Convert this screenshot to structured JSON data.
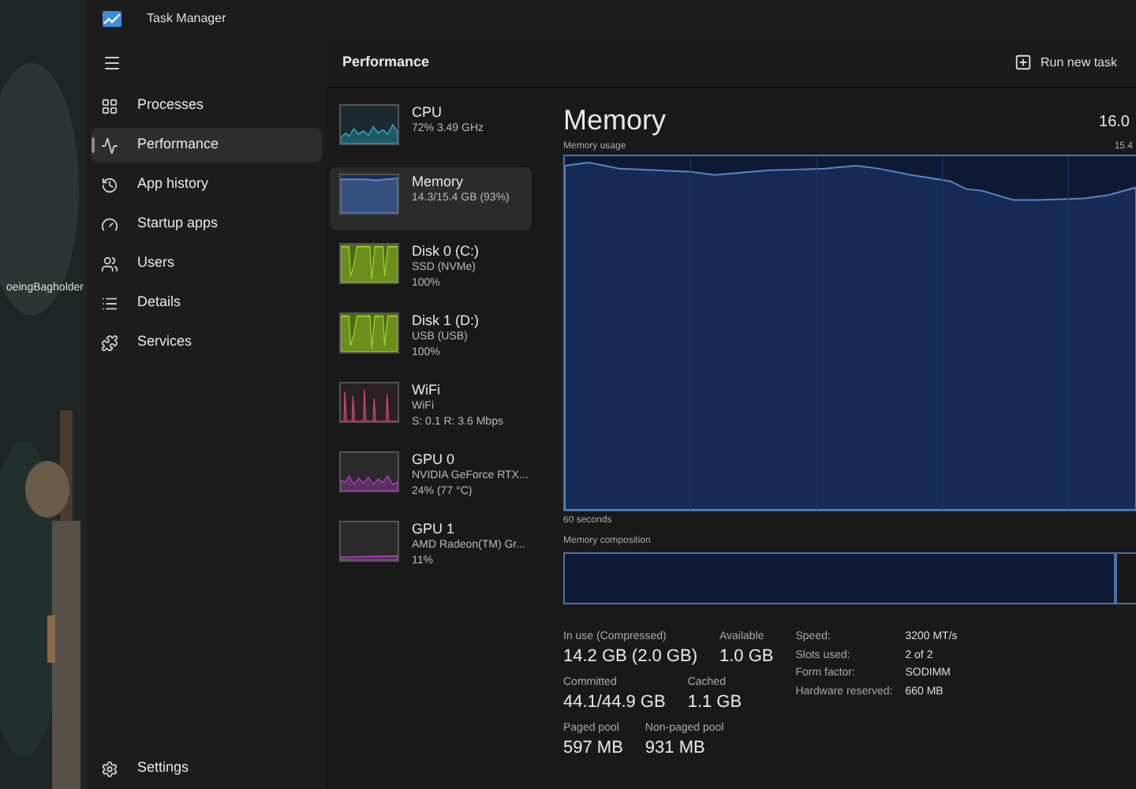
{
  "desktop": {
    "icon_label": "oeingBagholder"
  },
  "window": {
    "title": "Task Manager"
  },
  "sidebar": {
    "items": [
      {
        "label": "Processes",
        "kind": "processes",
        "selected": false
      },
      {
        "label": "Performance",
        "kind": "performance",
        "selected": true
      },
      {
        "label": "App history",
        "kind": "history",
        "selected": false
      },
      {
        "label": "Startup apps",
        "kind": "startup",
        "selected": false
      },
      {
        "label": "Users",
        "kind": "users",
        "selected": false
      },
      {
        "label": "Details",
        "kind": "details",
        "selected": false
      },
      {
        "label": "Services",
        "kind": "services",
        "selected": false
      }
    ],
    "settings": "Settings"
  },
  "header": {
    "title": "Performance",
    "action": "Run new task"
  },
  "devices": [
    {
      "kind": "cpu",
      "name": "CPU",
      "lines": [
        "72% 3.49 GHz"
      ],
      "selected": false
    },
    {
      "kind": "memory",
      "name": "Memory",
      "lines": [
        "14.3/15.4 GB (93%)"
      ],
      "selected": true
    },
    {
      "kind": "disk",
      "name": "Disk 0 (C:)",
      "lines": [
        "SSD (NVMe)",
        "100%"
      ],
      "selected": false
    },
    {
      "kind": "disk",
      "name": "Disk 1 (D:)",
      "lines": [
        "USB (USB)",
        "100%"
      ],
      "selected": false
    },
    {
      "kind": "wifi",
      "name": "WiFi",
      "lines": [
        "WiFi",
        "S: 0.1 R: 3.6 Mbps"
      ],
      "selected": false
    },
    {
      "kind": "gpu",
      "name": "GPU 0",
      "lines": [
        "NVIDIA GeForce RTX...",
        "24% (77 °C)"
      ],
      "selected": false
    },
    {
      "kind": "gpu1",
      "name": "GPU 1",
      "lines": [
        "AMD Radeon(TM) Gr...",
        "11%"
      ],
      "selected": false
    }
  ],
  "detail": {
    "title": "Memory",
    "total": "16.0",
    "usage_label": "Memory usage",
    "usage_max": "15.4",
    "time_label": "60 seconds",
    "composition_label": "Memory composition",
    "stats": [
      [
        {
          "label": "In use (Compressed)",
          "value": "14.2 GB (2.0 GB)"
        },
        {
          "label": "Available",
          "value": "1.0 GB"
        }
      ],
      [
        {
          "label": "Committed",
          "value": "44.1/44.9 GB"
        },
        {
          "label": "Cached",
          "value": "1.1 GB"
        }
      ],
      [
        {
          "label": "Paged pool",
          "value": "597 MB"
        },
        {
          "label": "Non-paged pool",
          "value": "931 MB"
        }
      ]
    ],
    "specs": [
      {
        "label": "Speed:",
        "value": "3200 MT/s"
      },
      {
        "label": "Slots used:",
        "value": "2 of 2"
      },
      {
        "label": "Form factor:",
        "value": "SODIMM"
      },
      {
        "label": "Hardware reserved:",
        "value": "660 MB"
      }
    ]
  }
}
